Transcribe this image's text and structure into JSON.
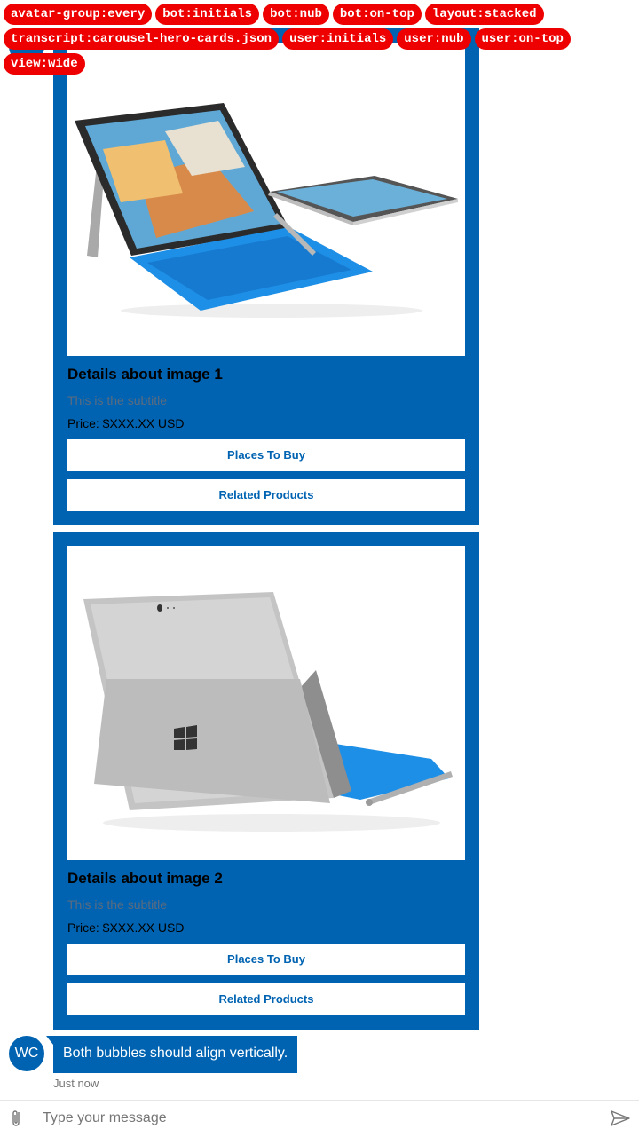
{
  "tags": [
    "avatar-group:every",
    "bot:initials",
    "bot:nub",
    "bot:on-top",
    "layout:stacked",
    "transcript:carousel-hero-cards.json",
    "user:initials",
    "user:nub",
    "user:on-top",
    "view:wide"
  ],
  "cards": [
    {
      "image": "surface-pro-4-laptop-photo",
      "title": "Details about image 1",
      "subtitle": "This is the subtitle",
      "text": "Price: $XXX.XX USD",
      "buttons": [
        "Places To Buy",
        "Related Products"
      ]
    },
    {
      "image": "surface-pro-4-back-photo",
      "title": "Details about image 2",
      "subtitle": "This is the subtitle",
      "text": "Price: $XXX.XX USD",
      "buttons": [
        "Places To Buy",
        "Related Products"
      ]
    }
  ],
  "message": {
    "avatar_initials": "WC",
    "text": "Both bubbles should align vertically.",
    "timestamp": "Just now"
  },
  "sendbox": {
    "placeholder": "Type your message"
  },
  "colors": {
    "accent": "#0063b1",
    "chip": "#ee0000",
    "subtitle": "#5a6b80",
    "timestamp": "#767676"
  },
  "icons": [
    "attachment-icon",
    "send-icon"
  ]
}
